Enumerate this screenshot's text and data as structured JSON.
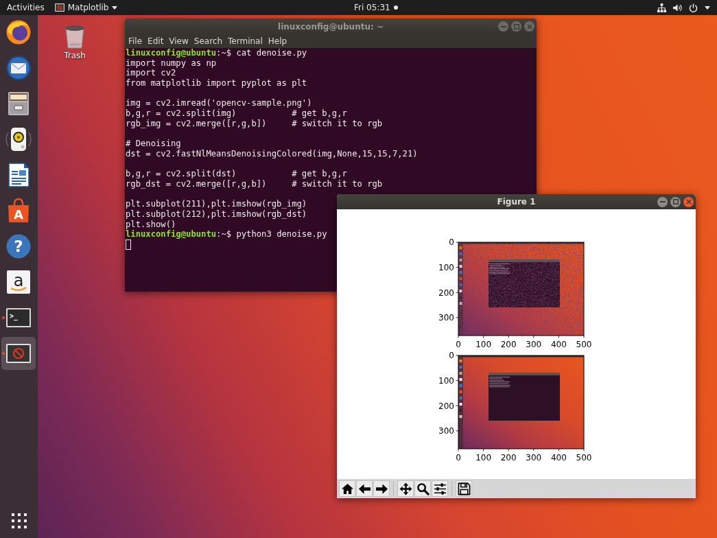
{
  "top_bar": {
    "activities": "Activities",
    "app_menu": "Matplotlib",
    "clock": "Fri 05:31",
    "notification": true,
    "status_icons": [
      {
        "kind": "network"
      },
      {
        "kind": "volume"
      },
      {
        "kind": "power"
      }
    ]
  },
  "dock": {
    "items": [
      {
        "kind": "browser",
        "running": false,
        "selected": false
      },
      {
        "kind": "mail",
        "running": false,
        "selected": false
      },
      {
        "kind": "files",
        "running": false,
        "selected": false
      },
      {
        "kind": "music",
        "running": false,
        "selected": false
      },
      {
        "kind": "writer",
        "running": false,
        "selected": false
      },
      {
        "kind": "software",
        "glyph": "A",
        "running": false,
        "selected": false
      },
      {
        "kind": "help",
        "glyph": "?",
        "running": false,
        "selected": false
      },
      {
        "kind": "shop",
        "glyph": "a",
        "running": false,
        "selected": false
      },
      {
        "kind": "terminal",
        "glyph": ">_",
        "running": true,
        "selected": false
      },
      {
        "kind": "figure",
        "running": true,
        "selected": true
      }
    ]
  },
  "desktop_icons": [
    {
      "label": "Trash"
    }
  ],
  "terminal": {
    "title": "linuxconfig@ubuntu: ~",
    "active": false,
    "menu": [
      "File",
      "Edit",
      "View",
      "Search",
      "Terminal",
      "Help"
    ],
    "blocks": [
      [
        {
          "prompt": "linuxconfig@ubuntu",
          "text": ":~$ cat denoise.py"
        },
        {
          "text": "import numpy as np"
        },
        {
          "text": "import cv2"
        },
        {
          "text": "from matplotlib import pyplot as plt"
        }
      ],
      [
        {
          "text": "img = cv2.imread('opencv-sample.png')"
        },
        {
          "text": "b,g,r = cv2.split(img)           # get b,g,r"
        },
        {
          "text": "rgb_img = cv2.merge([r,g,b])     # switch it to rgb"
        }
      ],
      [
        {
          "text": "# Denoising"
        },
        {
          "text": "dst = cv2.fastNlMeansDenoisingColored(img,None,15,15,7,21)"
        }
      ],
      [
        {
          "text": "b,g,r = cv2.split(dst)           # get b,g,r"
        },
        {
          "text": "rgb_dst = cv2.merge([r,g,b])     # switch it to rgb"
        }
      ],
      [
        {
          "text": "plt.subplot(211),plt.imshow(rgb_img)"
        },
        {
          "text": "plt.subplot(212),plt.imshow(rgb_dst)"
        },
        {
          "text": "plt.show()"
        },
        {
          "prompt": "linuxconfig@ubuntu",
          "text": ":~$ python3 denoise.py"
        }
      ]
    ],
    "cursor": true
  },
  "figure_window": {
    "title": "Figure 1",
    "active": true,
    "subplots": [
      {
        "noisy": true,
        "xticks": [
          "0",
          "100",
          "200",
          "300",
          "400",
          "500"
        ],
        "yticks": [
          "0",
          "100",
          "200",
          "300"
        ]
      },
      {
        "noisy": false,
        "xticks": [
          "0",
          "100",
          "200",
          "300",
          "400",
          "500"
        ],
        "yticks": [
          "0",
          "100",
          "200",
          "300"
        ]
      }
    ],
    "toolbar": [
      [
        {
          "kind": "home"
        },
        {
          "kind": "back"
        },
        {
          "kind": "forward"
        }
      ],
      [
        {
          "kind": "pan"
        },
        {
          "kind": "zoom"
        },
        {
          "kind": "configure"
        }
      ],
      [
        {
          "kind": "save"
        }
      ]
    ]
  }
}
